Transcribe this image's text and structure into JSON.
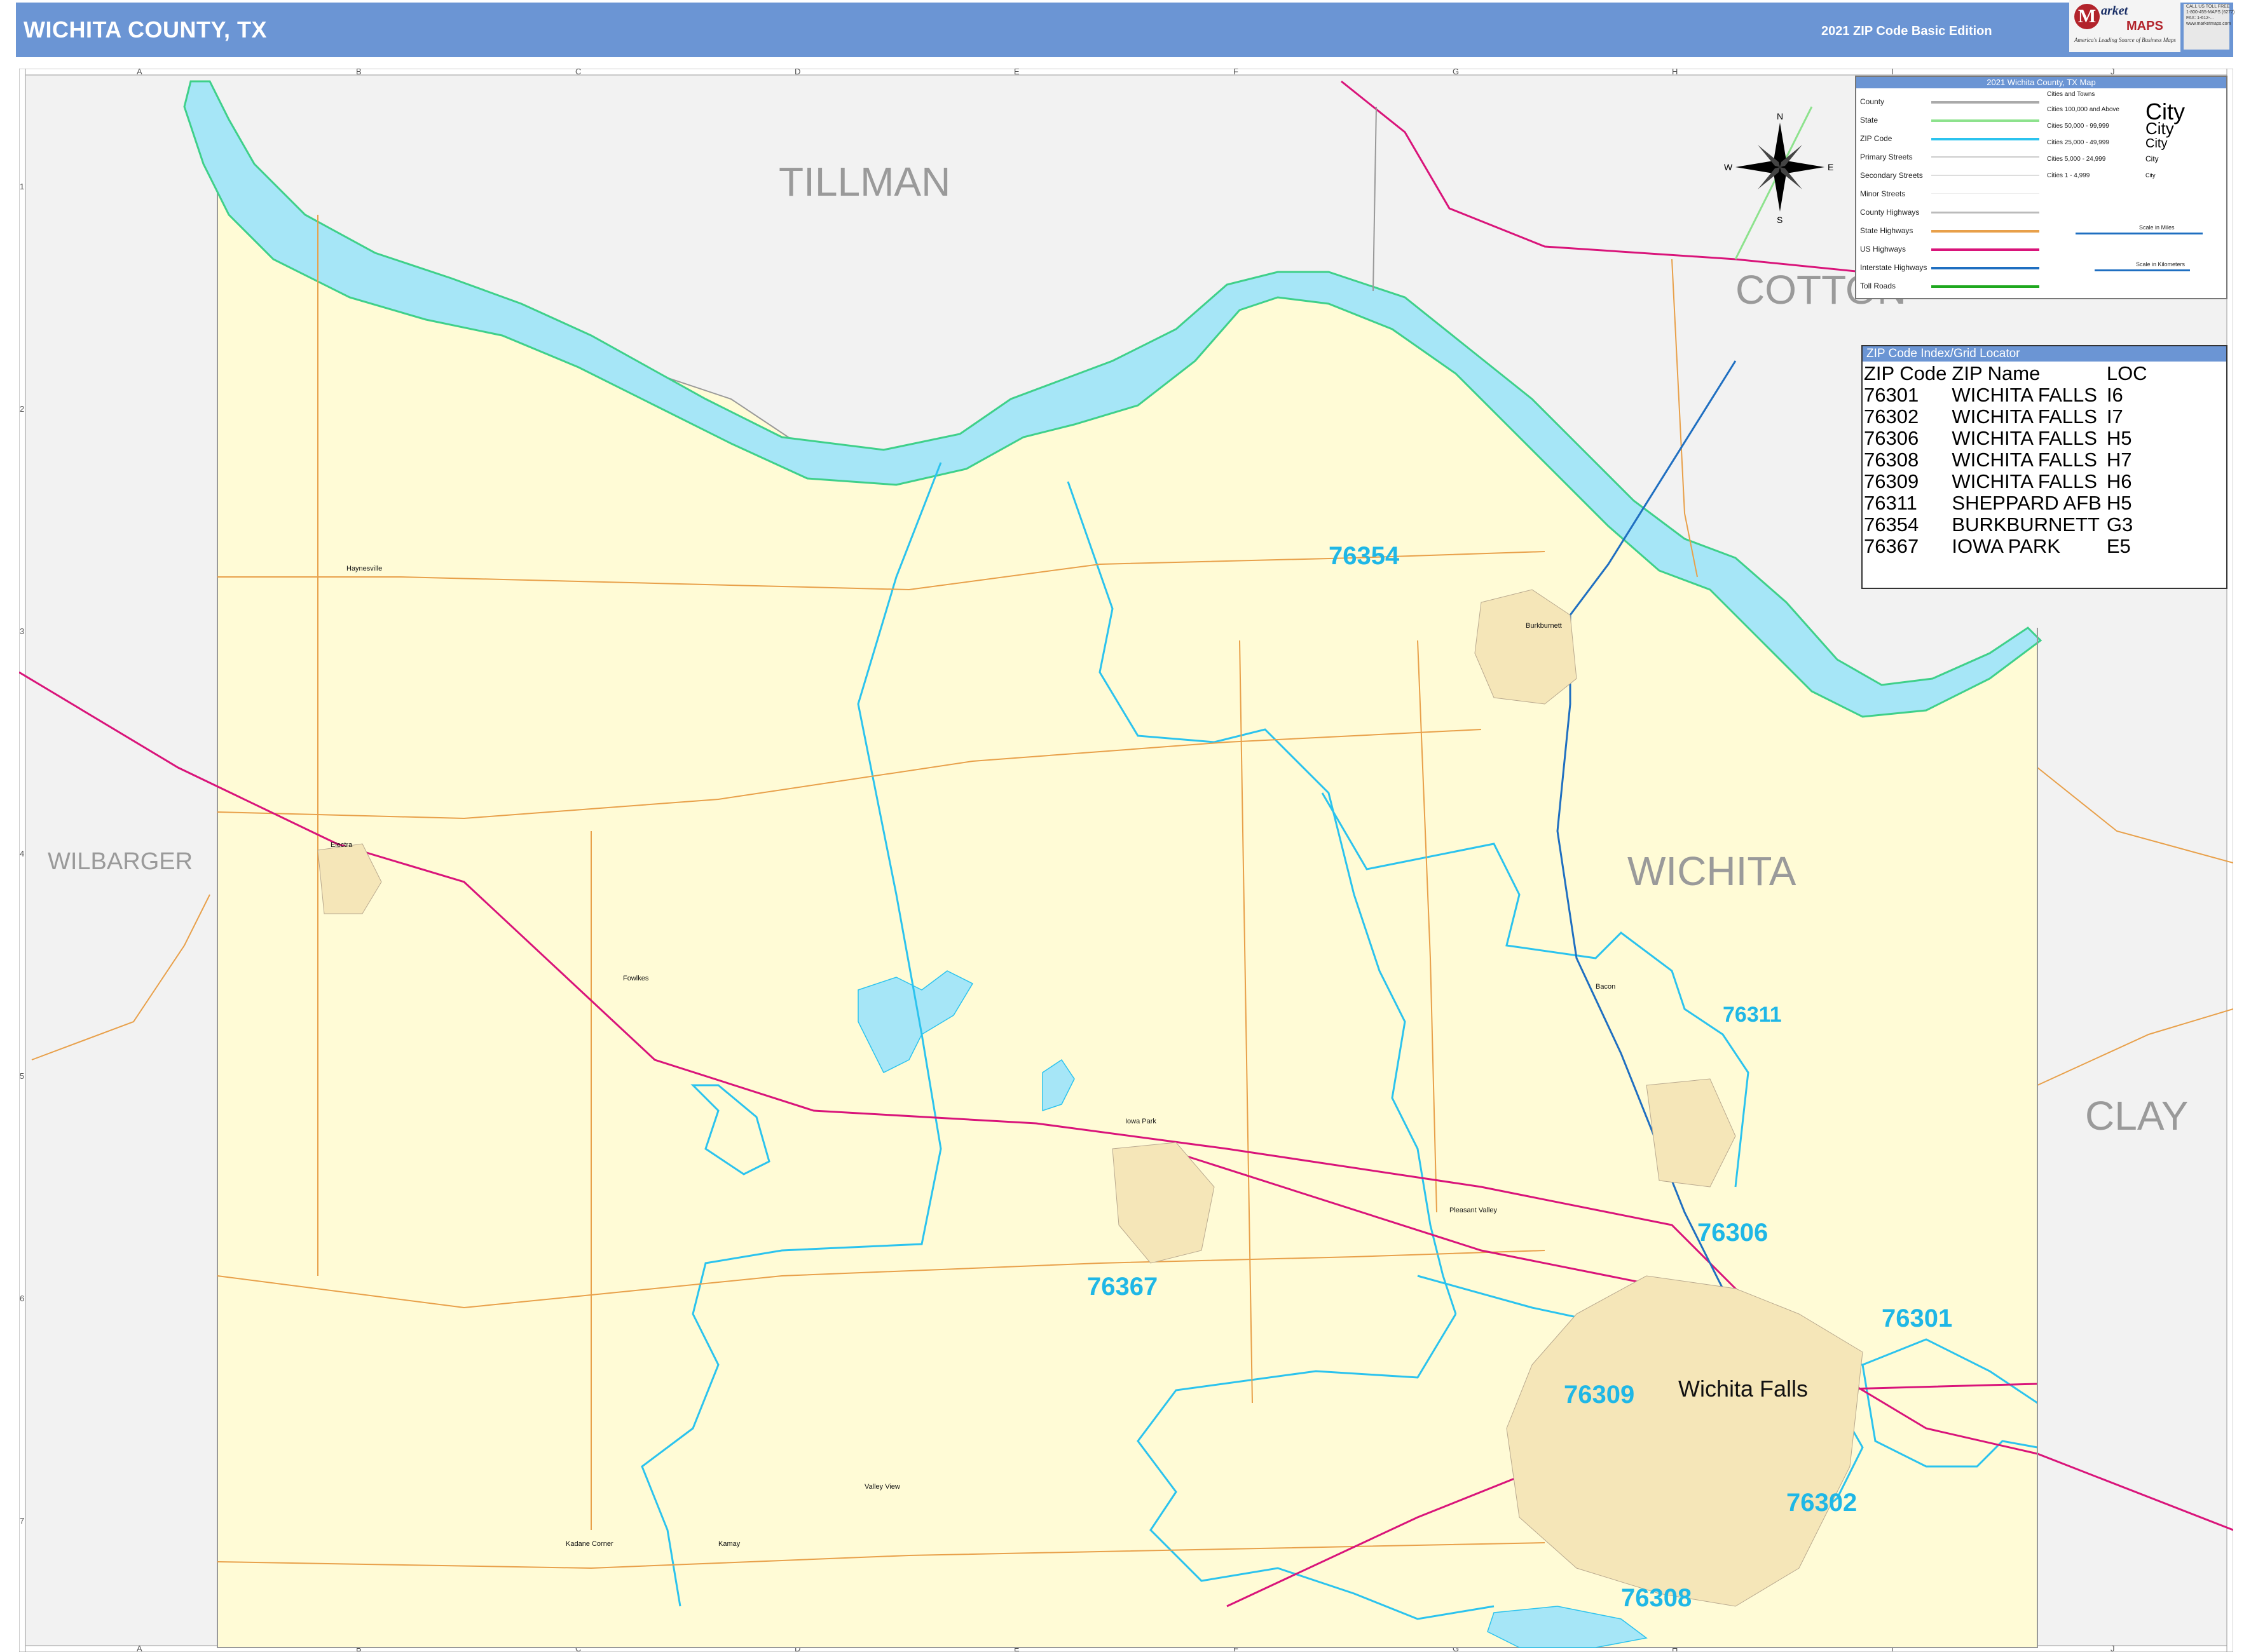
{
  "header": {
    "title": "WICHITA COUNTY, TX",
    "edition": "2021 ZIP Code Basic Edition",
    "logo": {
      "mark": "M",
      "brand_line1": "arket",
      "brand_line2": "MAPS",
      "tagline": "America's Leading Source of Business Maps",
      "contact_lines": [
        "CALL US TOLL FREE",
        "1-800-455-MAPS (6277)",
        "FAX: 1-612-...",
        "www.marketmaps.com"
      ]
    }
  },
  "grid": {
    "columns": [
      "A",
      "B",
      "C",
      "D",
      "E",
      "F",
      "G",
      "H",
      "I",
      "J"
    ],
    "rows": [
      "1",
      "2",
      "3",
      "4",
      "5",
      "6",
      "7"
    ]
  },
  "neighbor_labels": {
    "tillman": "TILLMAN",
    "cotton": "COTTON",
    "wilbarger": "WILBARGER",
    "wichita": "WICHITA",
    "clay": "CLAY"
  },
  "zip_labels": {
    "z76354": "76354",
    "z76311": "76311",
    "z76306": "76306",
    "z76367": "76367",
    "z76301": "76301",
    "z76309": "76309",
    "z76302": "76302",
    "z76308": "76308"
  },
  "cities": {
    "wichita_falls": "Wichita Falls",
    "burkburnett": "Burkburnett",
    "iowa_park": "Iowa Park",
    "electra": "Electra",
    "haynesville": "Haynesville",
    "fowlkes": "Fowlkes",
    "pleasant_valley": "Pleasant Valley",
    "valley_view": "Valley View",
    "kadane_corner": "Kadane Corner",
    "kamay": "Kamay",
    "bacon": "Bacon"
  },
  "compass": {
    "n": "N",
    "s": "S",
    "e": "E",
    "w": "W"
  },
  "legend": {
    "title": "2021 Wichita County, TX Map",
    "items": [
      {
        "label": "County",
        "color": "#aaaaaa"
      },
      {
        "label": "State",
        "color": "#8de28d"
      },
      {
        "label": "ZIP Code",
        "color": "#2bc3ee"
      },
      {
        "label": "Primary Streets",
        "color": "#cccccc"
      },
      {
        "label": "Secondary Streets",
        "color": "#dddddd"
      },
      {
        "label": "Minor Streets",
        "color": "#eeeeee"
      },
      {
        "label": "County Highways",
        "color": "#bbbbbb"
      },
      {
        "label": "State Highways",
        "color": "#e8a04a"
      },
      {
        "label": "US Highways",
        "color": "#d9147a"
      },
      {
        "label": "Interstate Highways",
        "color": "#1f6fc1"
      },
      {
        "label": "Toll Roads",
        "color": "#1fa81f"
      }
    ],
    "cities_header": "Cities and Towns",
    "city_classes": [
      {
        "label": "Cities 100,000 and Above",
        "sample": "City"
      },
      {
        "label": "Cities 50,000 - 99,999",
        "sample": "City"
      },
      {
        "label": "Cities 25,000 - 49,999",
        "sample": "City"
      },
      {
        "label": "Cities 5,000 - 24,999",
        "sample": "City"
      },
      {
        "label": "Cities 1 - 4,999",
        "sample": "City"
      }
    ],
    "scale_miles": "Scale in Miles",
    "scale_km": "Scale in Kilometers"
  },
  "zip_index": {
    "title": "ZIP Code Index/Grid Locator",
    "columns": [
      "ZIP Code",
      "ZIP Name",
      "LOC"
    ],
    "rows": [
      [
        "76301",
        "WICHITA FALLS",
        "I6"
      ],
      [
        "76302",
        "WICHITA FALLS",
        "I7"
      ],
      [
        "76306",
        "WICHITA FALLS",
        "H5"
      ],
      [
        "76308",
        "WICHITA FALLS",
        "H7"
      ],
      [
        "76309",
        "WICHITA FALLS",
        "H6"
      ],
      [
        "76311",
        "SHEPPARD AFB",
        "H5"
      ],
      [
        "76354",
        "BURKBURNETT",
        "G3"
      ],
      [
        "76367",
        "IOWA PARK",
        "E5"
      ]
    ]
  },
  "colors": {
    "header": "#6b95d4",
    "county_fill": "#fffbd6",
    "outside_fill": "#f2f2f2",
    "water": "#a6e6f7",
    "zip_boundary": "#2bc3ee",
    "state_road": "#e8a04a",
    "us_highway": "#d9147a",
    "interstate": "#1f6fc1",
    "state_line": "#8de28d",
    "county_line": "#999999"
  }
}
